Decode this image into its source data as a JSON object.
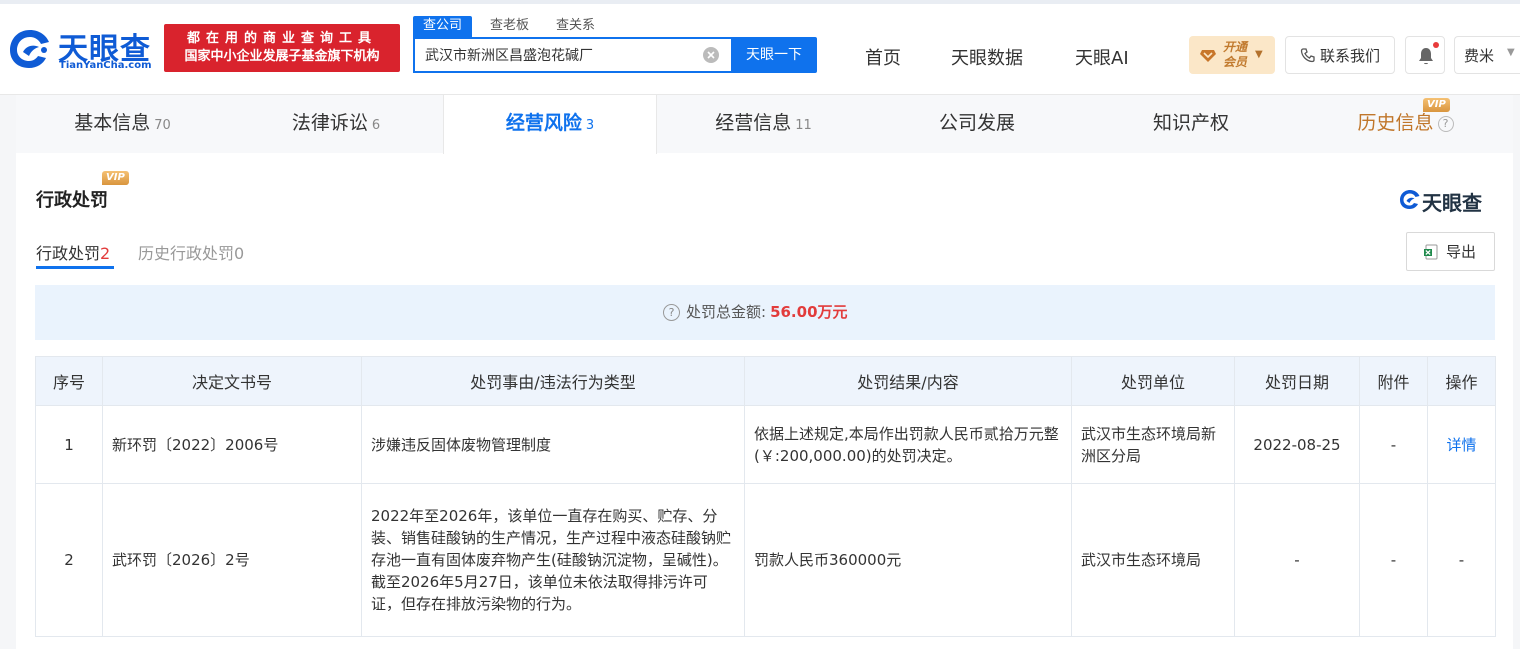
{
  "header": {
    "logo_cn": "天眼查",
    "logo_en": "TianYanCha.com",
    "slogan_line1": "都在用的商业查询工具",
    "slogan_line2": "国家中小企业发展子基金旗下机构",
    "search_tabs": [
      "查公司",
      "查老板",
      "查关系"
    ],
    "search_value": "武汉市新洲区昌盛泡花碱厂",
    "search_button": "天眼一下",
    "nav": [
      "首页",
      "天眼数据",
      "天眼AI"
    ],
    "vip_label": "开通会员",
    "contact_label": "联系我们",
    "user_name": "费米"
  },
  "main_tabs": [
    {
      "label": "基本信息",
      "count": "70"
    },
    {
      "label": "法律诉讼",
      "count": "6"
    },
    {
      "label": "经营风险",
      "count": "3"
    },
    {
      "label": "经营信息",
      "count": "11"
    },
    {
      "label": "公司发展",
      "count": ""
    },
    {
      "label": "知识产权",
      "count": ""
    },
    {
      "label": "历史信息",
      "count": ""
    }
  ],
  "vip_badge": "VIP",
  "section": {
    "title": "行政处罚",
    "brand": "天眼查",
    "sub_tabs": [
      {
        "label": "行政处罚",
        "count": "2"
      },
      {
        "label": "历史行政处罚",
        "count": "0"
      }
    ],
    "export_label": "导出",
    "summary_label": "处罚总金额:",
    "summary_value": "56.00万元"
  },
  "table": {
    "headers": [
      "序号",
      "决定文书号",
      "处罚事由/违法行为类型",
      "处罚结果/内容",
      "处罚单位",
      "处罚日期",
      "附件",
      "操作"
    ],
    "rows": [
      {
        "index": "1",
        "doc_no": "新环罚〔2022〕2006号",
        "reason": "涉嫌违反固体废物管理制度",
        "result": "依据上述规定,本局作出罚款人民币贰拾万元整(￥:200,000.00)的处罚决定。",
        "authority": "武汉市生态环境局新洲区分局",
        "date": "2022-08-25",
        "attachment": "-",
        "action": "详情"
      },
      {
        "index": "2",
        "doc_no": "武环罚〔2026〕2号",
        "reason": "2022年至2026年，该单位一直存在购买、贮存、分装、销售硅酸钠的生产情况，生产过程中液态硅酸钠贮存池一直有固体废弃物产生(硅酸钠沉淀物，呈碱性)。截至2026年5月27日，该单位未依法取得排污许可证，但存在排放污染物的行为。",
        "result": "罚款人民币360000元",
        "authority": "武汉市生态环境局",
        "date": "-",
        "attachment": "-",
        "action": "-"
      }
    ]
  },
  "colors": {
    "brand_blue": "#0f72ed",
    "logo_blue": "#0f5bd5",
    "slogan_red": "#d9232d",
    "amount_red": "#e23b3b",
    "vip_gold": "#c0762a"
  },
  "icons": [
    "tianyancha-logo-icon",
    "clear-icon",
    "vip-diamond-icon",
    "phone-icon",
    "bell-icon",
    "help-icon",
    "excel-icon",
    "question-icon"
  ]
}
